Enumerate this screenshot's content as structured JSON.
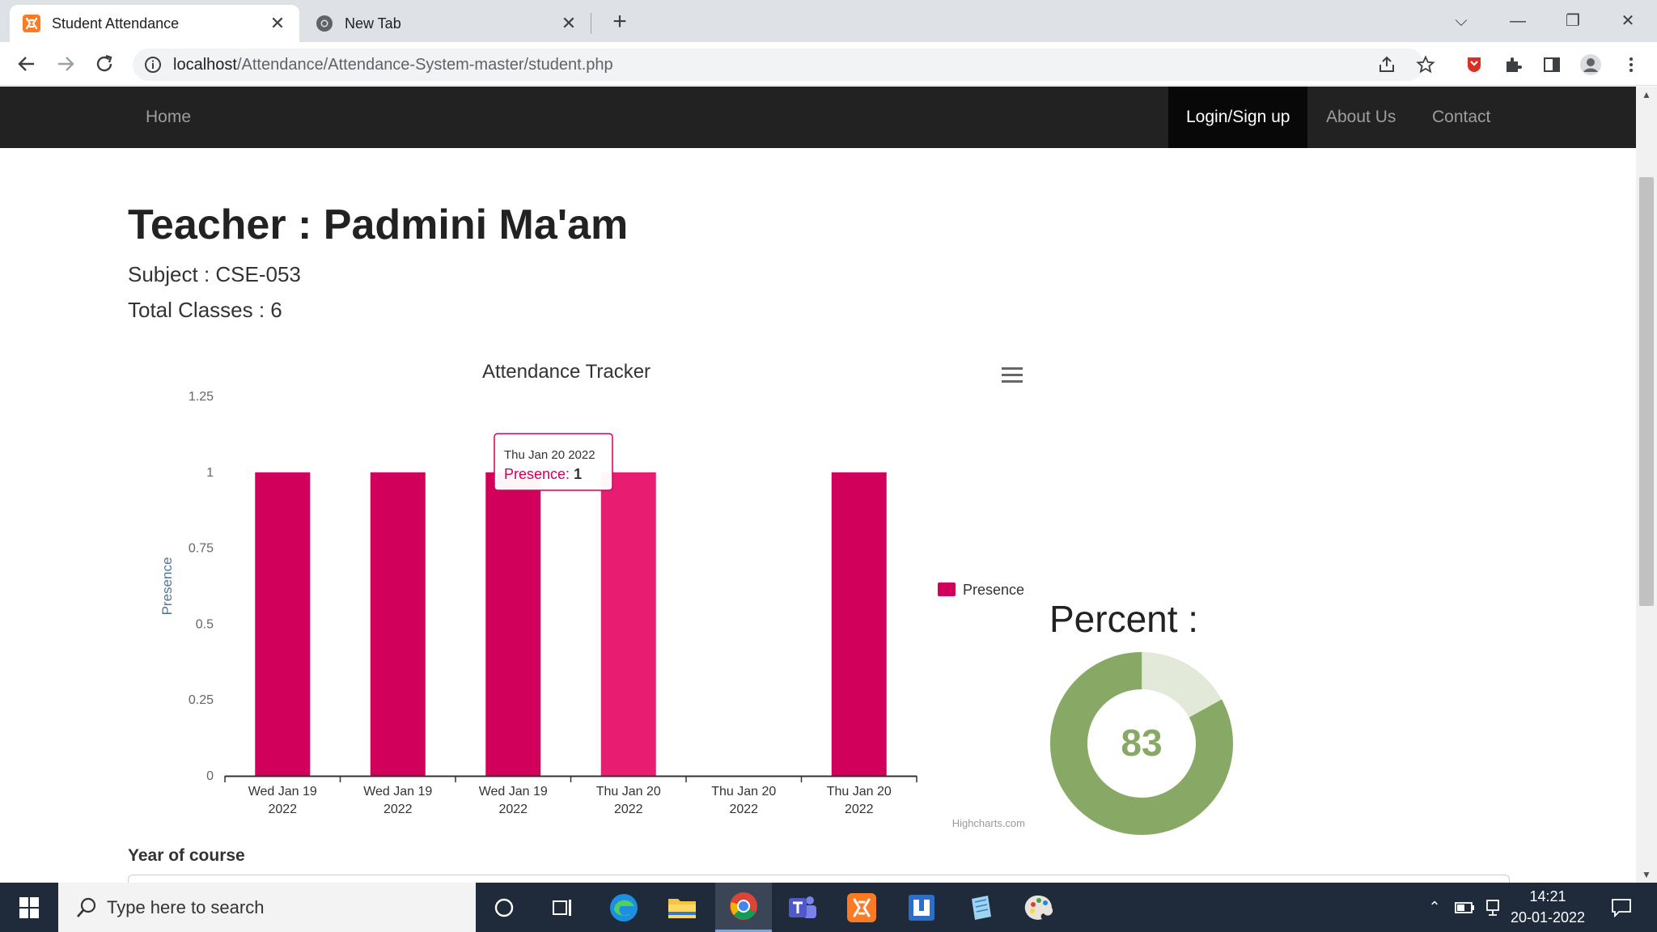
{
  "browser": {
    "tabs": [
      {
        "title": "Student Attendance",
        "active": true
      },
      {
        "title": "New Tab",
        "active": false
      }
    ],
    "url_host": "localhost",
    "url_path": "/Attendance/Attendance-System-master/student.php"
  },
  "navbar": {
    "home": "Home",
    "login": "Login/Sign up",
    "about": "About Us",
    "contact": "Contact"
  },
  "page": {
    "title": "Teacher : Padmini Ma'am",
    "subject": "Subject : CSE-053",
    "total_classes": "Total Classes : 6",
    "percent_label": "Percent :",
    "year_label": "Year of course"
  },
  "chart_data": {
    "type": "bar",
    "title": "Attendance Tracker",
    "ylabel": "Presence",
    "xlabel": "",
    "ylim": [
      0,
      1.25
    ],
    "yticks": [
      "0",
      "0.25",
      "0.5",
      "0.75",
      "1",
      "1.25"
    ],
    "categories": [
      "Wed Jan 19 2022",
      "Wed Jan 19 2022",
      "Wed Jan 19 2022",
      "Thu Jan 20 2022",
      "Thu Jan 20 2022",
      "Thu Jan 20 2022"
    ],
    "series": [
      {
        "name": "Presence",
        "values": [
          1,
          1,
          1,
          1,
          0,
          1
        ]
      }
    ],
    "bar_color": "#d1005a",
    "hover_color": "#e81d72",
    "highlighted_index": 3,
    "legend": "right",
    "credits": "Highcharts.com",
    "tooltip": {
      "date": "Thu Jan 20 2022",
      "series": "Presence",
      "value": "1"
    }
  },
  "percent": {
    "value": 83,
    "fill_color": "#88a966",
    "track_color": "#e2e9d8"
  },
  "taskbar": {
    "search_placeholder": "Type here to search",
    "time": "14:21",
    "date": "20-01-2022"
  }
}
